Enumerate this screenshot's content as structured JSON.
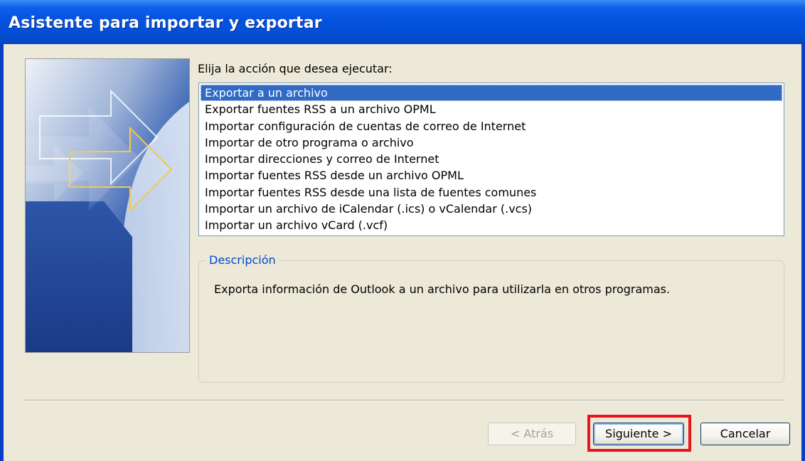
{
  "window": {
    "title": "Asistente para importar y exportar"
  },
  "main": {
    "prompt": "Elija la acción que desea ejecutar:",
    "actions": [
      "Exportar a un archivo",
      "Exportar fuentes RSS a un archivo OPML",
      "Importar configuración de cuentas de correo de Internet",
      "Importar de otro programa o archivo",
      "Importar direcciones y correo de Internet",
      "Importar fuentes RSS desde un archivo OPML",
      "Importar fuentes RSS desde una lista de fuentes comunes",
      "Importar un archivo de iCalendar (.ics) o vCalendar (.vcs)",
      "Importar un archivo vCard (.vcf)"
    ],
    "selected_index": 0
  },
  "description": {
    "legend": "Descripción",
    "text": "Exporta información de Outlook a un archivo para utilizarla en otros programas."
  },
  "buttons": {
    "back_label": "< Atrás",
    "back_enabled": false,
    "next_label": "Siguiente >",
    "next_highlighted": true,
    "cancel_label": "Cancelar"
  },
  "colors": {
    "titlebar": "#0652e0",
    "selection": "#316ac5",
    "legend_text": "#0046d5",
    "highlight_box": "#e8141c"
  }
}
